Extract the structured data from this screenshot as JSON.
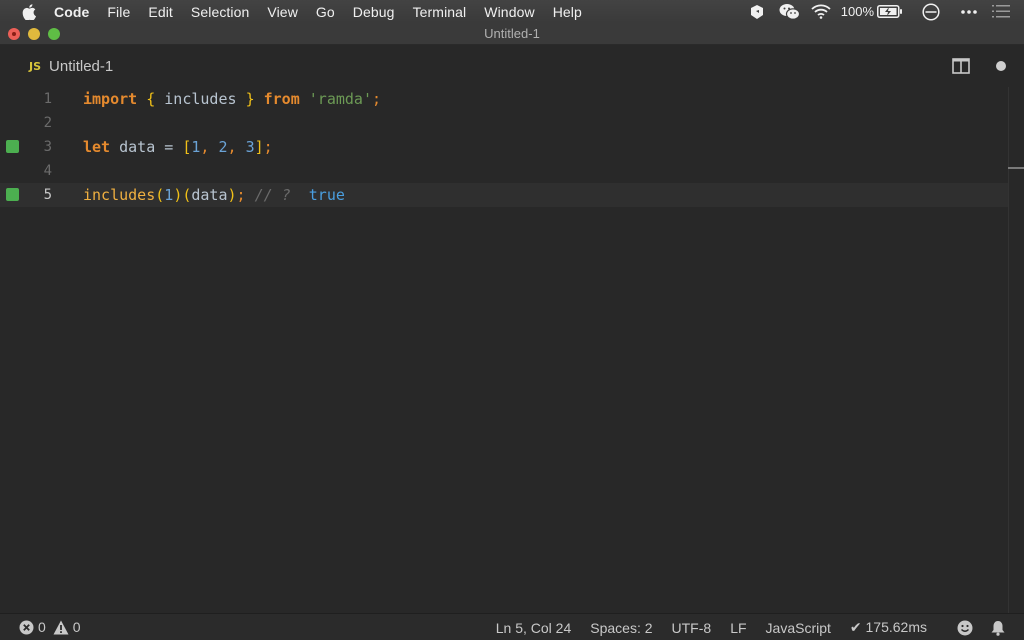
{
  "menubar": {
    "app_name": "Code",
    "items": [
      "File",
      "Edit",
      "Selection",
      "View",
      "Go",
      "Debug",
      "Terminal",
      "Window",
      "Help"
    ],
    "battery_percent": "100%",
    "status_icons": [
      "dropbox-like-icon",
      "wechat-icon",
      "wifi-icon",
      "battery-charging-icon",
      "clock-icon",
      "more-icon",
      "notification-list-icon"
    ]
  },
  "window": {
    "title": "Untitled-1"
  },
  "tab": {
    "badge": "JS",
    "label": "Untitled-1"
  },
  "editor": {
    "lines": [
      {
        "number": "1",
        "marker": false,
        "active": false,
        "tokens": [
          {
            "t": "import",
            "c": "tok-kw"
          },
          {
            "t": " ",
            "c": "tok-ident"
          },
          {
            "t": "{",
            "c": "tok-brace"
          },
          {
            "t": " includes ",
            "c": "tok-ident"
          },
          {
            "t": "}",
            "c": "tok-brace"
          },
          {
            "t": " ",
            "c": "tok-ident"
          },
          {
            "t": "from",
            "c": "tok-kw"
          },
          {
            "t": " ",
            "c": "tok-ident"
          },
          {
            "t": "'ramda'",
            "c": "tok-str"
          },
          {
            "t": ";",
            "c": "tok-punct"
          }
        ]
      },
      {
        "number": "2",
        "marker": false,
        "active": false,
        "tokens": []
      },
      {
        "number": "3",
        "marker": true,
        "active": false,
        "tokens": [
          {
            "t": "let",
            "c": "tok-kw"
          },
          {
            "t": " data = ",
            "c": "tok-ident"
          },
          {
            "t": "[",
            "c": "tok-brace"
          },
          {
            "t": "1",
            "c": "tok-num"
          },
          {
            "t": ", ",
            "c": "tok-punct"
          },
          {
            "t": "2",
            "c": "tok-num"
          },
          {
            "t": ", ",
            "c": "tok-punct"
          },
          {
            "t": "3",
            "c": "tok-num"
          },
          {
            "t": "]",
            "c": "tok-brace"
          },
          {
            "t": ";",
            "c": "tok-punct"
          }
        ]
      },
      {
        "number": "4",
        "marker": false,
        "active": false,
        "tokens": []
      },
      {
        "number": "5",
        "marker": true,
        "active": true,
        "tokens": [
          {
            "t": "includes",
            "c": "tok-fn"
          },
          {
            "t": "(",
            "c": "tok-brace"
          },
          {
            "t": "1",
            "c": "tok-num"
          },
          {
            "t": ")",
            "c": "tok-brace"
          },
          {
            "t": "(",
            "c": "tok-brace"
          },
          {
            "t": "data",
            "c": "tok-ident"
          },
          {
            "t": ")",
            "c": "tok-brace"
          },
          {
            "t": ";",
            "c": "tok-punct"
          },
          {
            "t": " // ? ",
            "c": "tok-comment"
          },
          {
            "t": " true",
            "c": "tok-result"
          }
        ]
      }
    ]
  },
  "statusbar": {
    "errors": "0",
    "warnings": "0",
    "cursor_position": "Ln 5, Col 24",
    "indentation": "Spaces: 2",
    "encoding": "UTF-8",
    "line_ending": "LF",
    "language": "JavaScript",
    "timing": "✔ 175.62ms"
  },
  "colors": {
    "marker_green": "#4caf50",
    "keyword": "#e58a2e",
    "brace": "#f0c018",
    "string": "#6c9a55",
    "number": "#6ba3d6",
    "result": "#4a9fe0",
    "editor_bg": "#282828"
  }
}
